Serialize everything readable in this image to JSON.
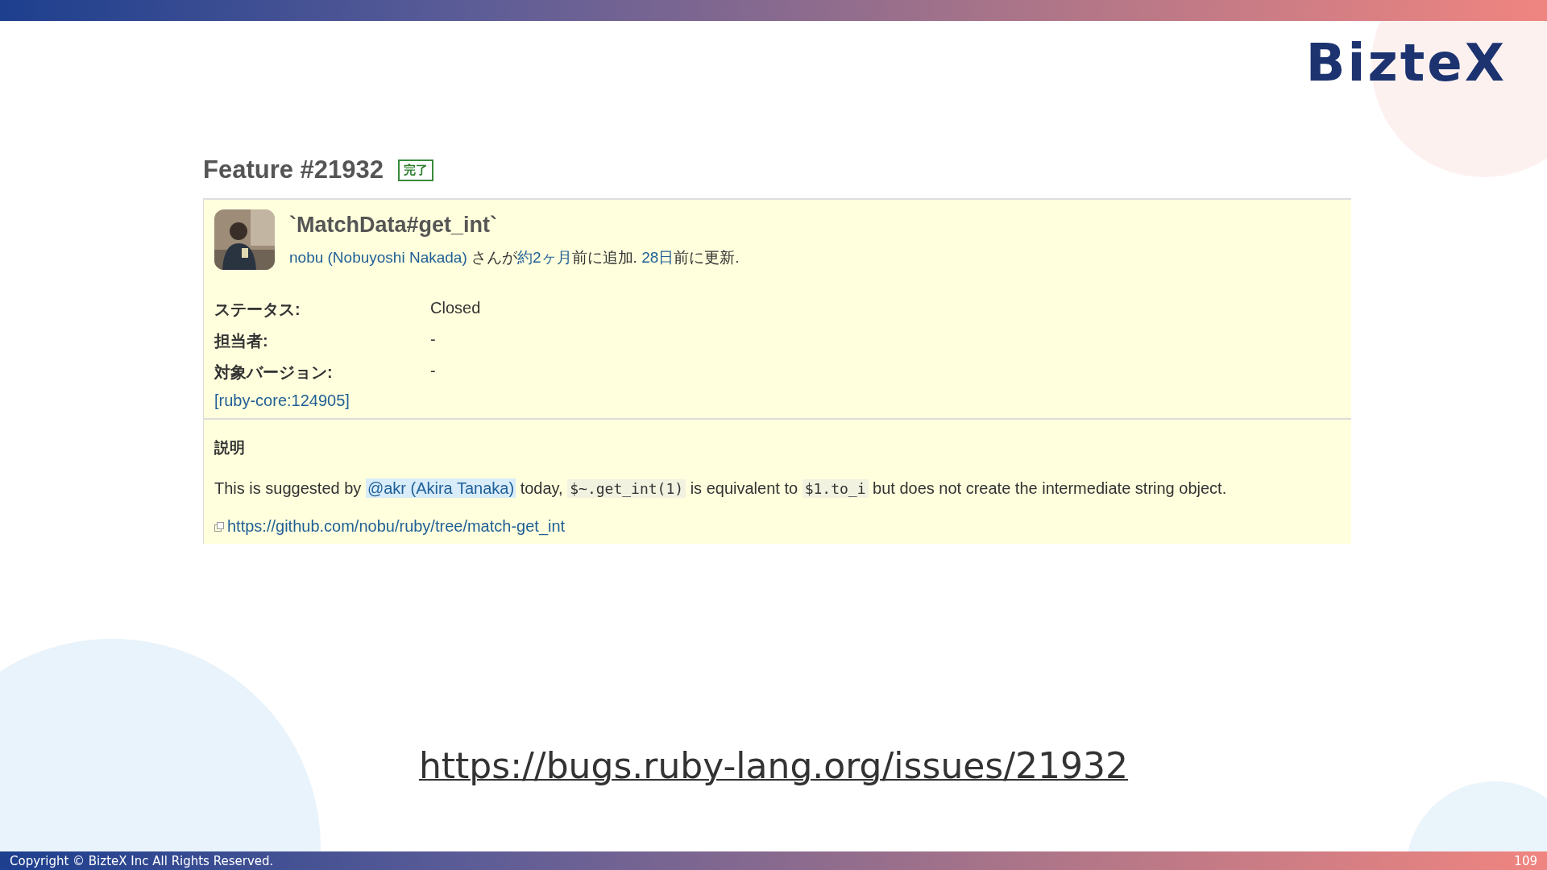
{
  "logo": {
    "text": "BizteX"
  },
  "issue": {
    "heading": "Feature #21932",
    "status_badge": "完了",
    "subject": "`MatchData#get_int`",
    "author_line": [
      {
        "kind": "link",
        "text": "nobu (Nobuyoshi Nakada)"
      },
      {
        "kind": "text",
        "text": " さんが"
      },
      {
        "kind": "link",
        "text": "約2ヶ月"
      },
      {
        "kind": "text",
        "text": "前に追加. "
      },
      {
        "kind": "link",
        "text": "28日"
      },
      {
        "kind": "text",
        "text": "前に更新."
      }
    ],
    "attributes": [
      {
        "label": "ステータス:",
        "value": "Closed"
      },
      {
        "label": "担当者:",
        "value": "-"
      },
      {
        "label": "対象バージョン:",
        "value": "-"
      }
    ],
    "reference_link": "[ruby-core:124905]",
    "description": {
      "heading": "説明",
      "paragraph": [
        {
          "kind": "text",
          "text": "This is suggested by "
        },
        {
          "kind": "mention",
          "text": "@akr (Akira Tanaka)"
        },
        {
          "kind": "text",
          "text": " today, "
        },
        {
          "kind": "code",
          "text": "$~.get_int(1)"
        },
        {
          "kind": "text",
          "text": " is equivalent to "
        },
        {
          "kind": "code",
          "text": "$1.to_i"
        },
        {
          "kind": "text",
          "text": " but does not create the intermediate string object."
        }
      ],
      "external_link": "https://github.com/nobu/ruby/tree/match-get_int"
    }
  },
  "slide_url": "https://bugs.ruby-lang.org/issues/21932",
  "footer": {
    "copyright": "Copyright © BizteX Inc All Rights Reserved.",
    "page_number": "109"
  }
}
